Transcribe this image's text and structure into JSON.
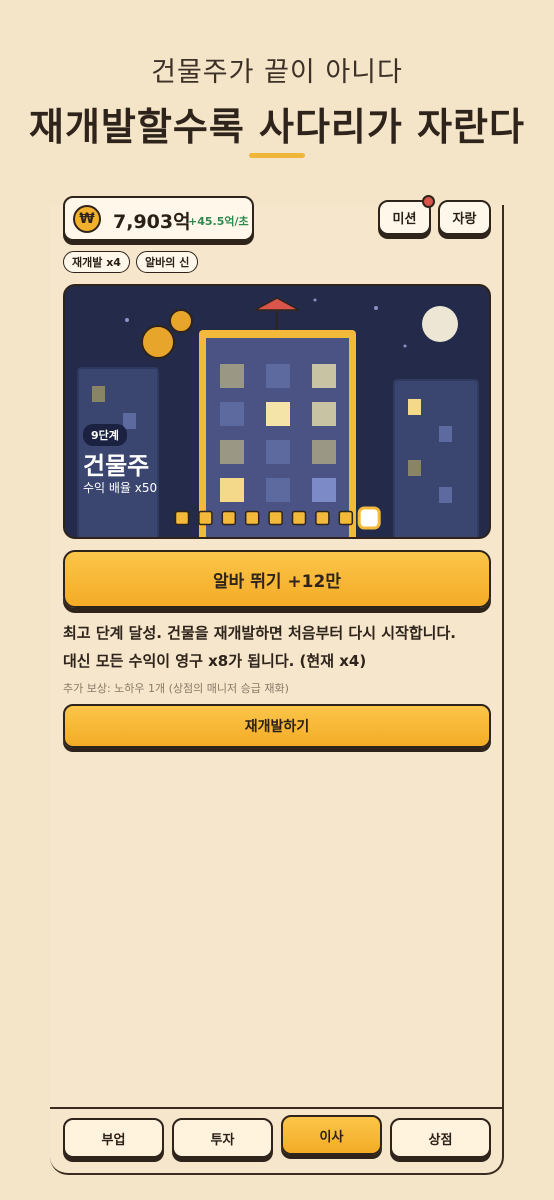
{
  "promo": {
    "subtitle": "건물주가 끝이 아니다",
    "title": "재개발할수록 사다리가 자란다"
  },
  "status": {
    "coin_symbol": "₩",
    "money": "7,903억",
    "rate": "+45.5억/초",
    "mission_label": "미션",
    "mission_has_alert": true,
    "brag_label": "자랑"
  },
  "chips": [
    "재개발 x4",
    "알바의 신"
  ],
  "scene": {
    "level": "9단계",
    "building_name": "건물주",
    "multiplier": "수익 배율 x50",
    "progress_steps_filled": 8,
    "progress_steps_total": 9
  },
  "actions": {
    "main_button": "알바 뛰기 +12만",
    "desc_line1": "최고 단계 달성. 건물을 재개발하면 처음부터 다시 시작합니다.",
    "desc_line2": "대신 모든 수익이 영구 x8가 됩니다. (현재 x4)",
    "extra_reward": "추가 보상: 노하우 1개 (상점의 매니저 승급 재화)",
    "redevelop_button": "재개발하기"
  },
  "tabs": [
    {
      "label": "부업",
      "active": false
    },
    {
      "label": "투자",
      "active": false
    },
    {
      "label": "이사",
      "active": true
    },
    {
      "label": "상점",
      "active": false
    }
  ],
  "colors": {
    "background": "#f4e4c8",
    "accent": "#f3ac26",
    "ink": "#2f241b",
    "night_sky": "#232a4a",
    "rate_green": "#2f8a4f",
    "alert_red": "#d9544a"
  }
}
